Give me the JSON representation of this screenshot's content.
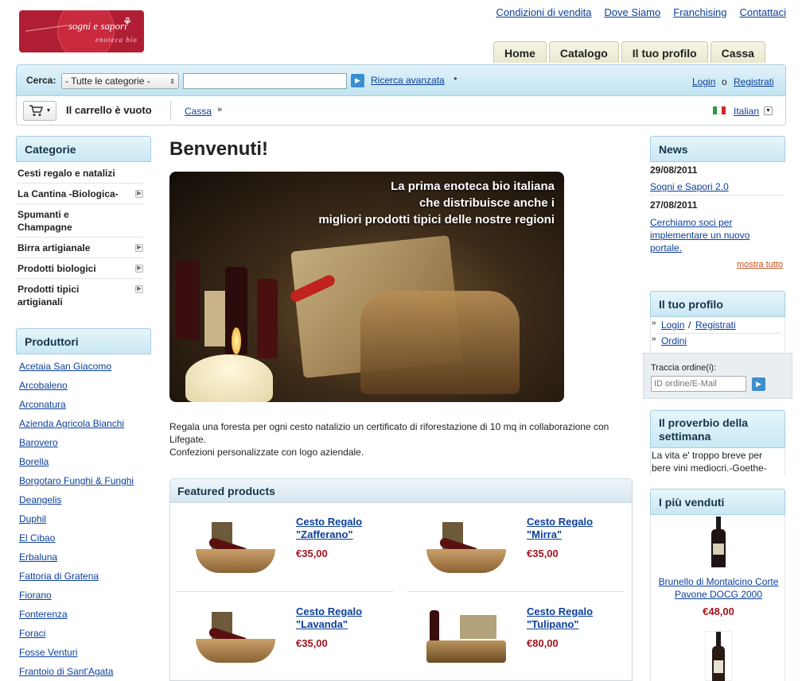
{
  "logo": {
    "title": "sogni e sapori",
    "subtitle": "enoteca bio"
  },
  "top_links": [
    "Condizioni di vendita",
    "Dove Siamo",
    "Franchising",
    "Contattaci"
  ],
  "tabs": [
    "Home",
    "Catalogo",
    "Il tuo profilo",
    "Cassa"
  ],
  "search": {
    "label": "Cerca:",
    "category_selected": "- Tutte le categorie -",
    "query": "",
    "advanced_link": "Ricerca avanzata",
    "login_link": "Login",
    "or_text": "o",
    "register_link": "Registrati"
  },
  "cart": {
    "status": "Il carrello è vuoto",
    "checkout_link": "Cassa",
    "language": "Italian"
  },
  "categories": {
    "title": "Categorie",
    "items": [
      {
        "label": "Cesti regalo e natalizi"
      },
      {
        "label": "La Cantina -Biologica-"
      },
      {
        "label": "Spumanti e Champagne"
      },
      {
        "label": "Birra artigianale"
      },
      {
        "label": "Prodotti biologici"
      },
      {
        "label": "Prodotti tipici artigianali"
      }
    ]
  },
  "producers": {
    "title": "Produttori",
    "items": [
      "Acetaia San Giacomo",
      "Arcobaleno",
      "Arconatura",
      "Azienda Agricola Bianchi",
      "Barovero",
      "Borella",
      "Borgotaro Funghi & Funghi",
      "Deangelis",
      "Duphil",
      "El Cibao",
      "Erbaluna",
      "Fattoria di Gratena",
      "Fiorano",
      "Fonterenza",
      "Foraci",
      "Fosse Venturi",
      "Frantoio di Sant'Agata"
    ]
  },
  "main": {
    "title": "Benvenuti!",
    "hero_text": [
      "La prima enoteca bio italiana",
      "che distribuisce anche i",
      "migliori prodotti tipici delle nostre regioni"
    ],
    "intro_1": "Regala una foresta per ogni cesto natalizio un certificato di riforestazione di 10 mq in collaborazione con Lifegate.",
    "intro_2": "Confezioni personalizzate con logo aziendale.",
    "featured_title": "Featured products",
    "featured": [
      {
        "name": "Cesto Regalo \"Zafferano\"",
        "price": "€35,00"
      },
      {
        "name": "Cesto Regalo \"Mirra\"",
        "price": "€35,00"
      },
      {
        "name": "Cesto Regalo \"Lavanda\"",
        "price": "€35,00"
      },
      {
        "name": "Cesto Regalo \"Tulipano\"",
        "price": "€80,00"
      }
    ]
  },
  "news": {
    "title": "News",
    "items": [
      {
        "date": "29/08/2011",
        "text": "Sogni e Sapori 2.0"
      },
      {
        "date": "27/08/2011",
        "text": "Cerchiamo soci per implementare un nuovo portale."
      }
    ],
    "more": "mostra tutto"
  },
  "profile": {
    "title": "Il tuo profilo",
    "login": "Login",
    "sep": "/",
    "register": "Registrati",
    "orders": "Ordini",
    "track_label": "Traccia ordine(i):",
    "track_placeholder": "ID ordine/E-Mail"
  },
  "proverb": {
    "title": "Il proverbio della settimana",
    "text": "La vita e' troppo breve per bere vini mediocri.-Goethe-"
  },
  "bestsellers": {
    "title": "I più venduti",
    "items": [
      {
        "name": "Brunello di Montalcino Corte Pavone DOCG 2000",
        "price": "€48,00"
      }
    ]
  }
}
